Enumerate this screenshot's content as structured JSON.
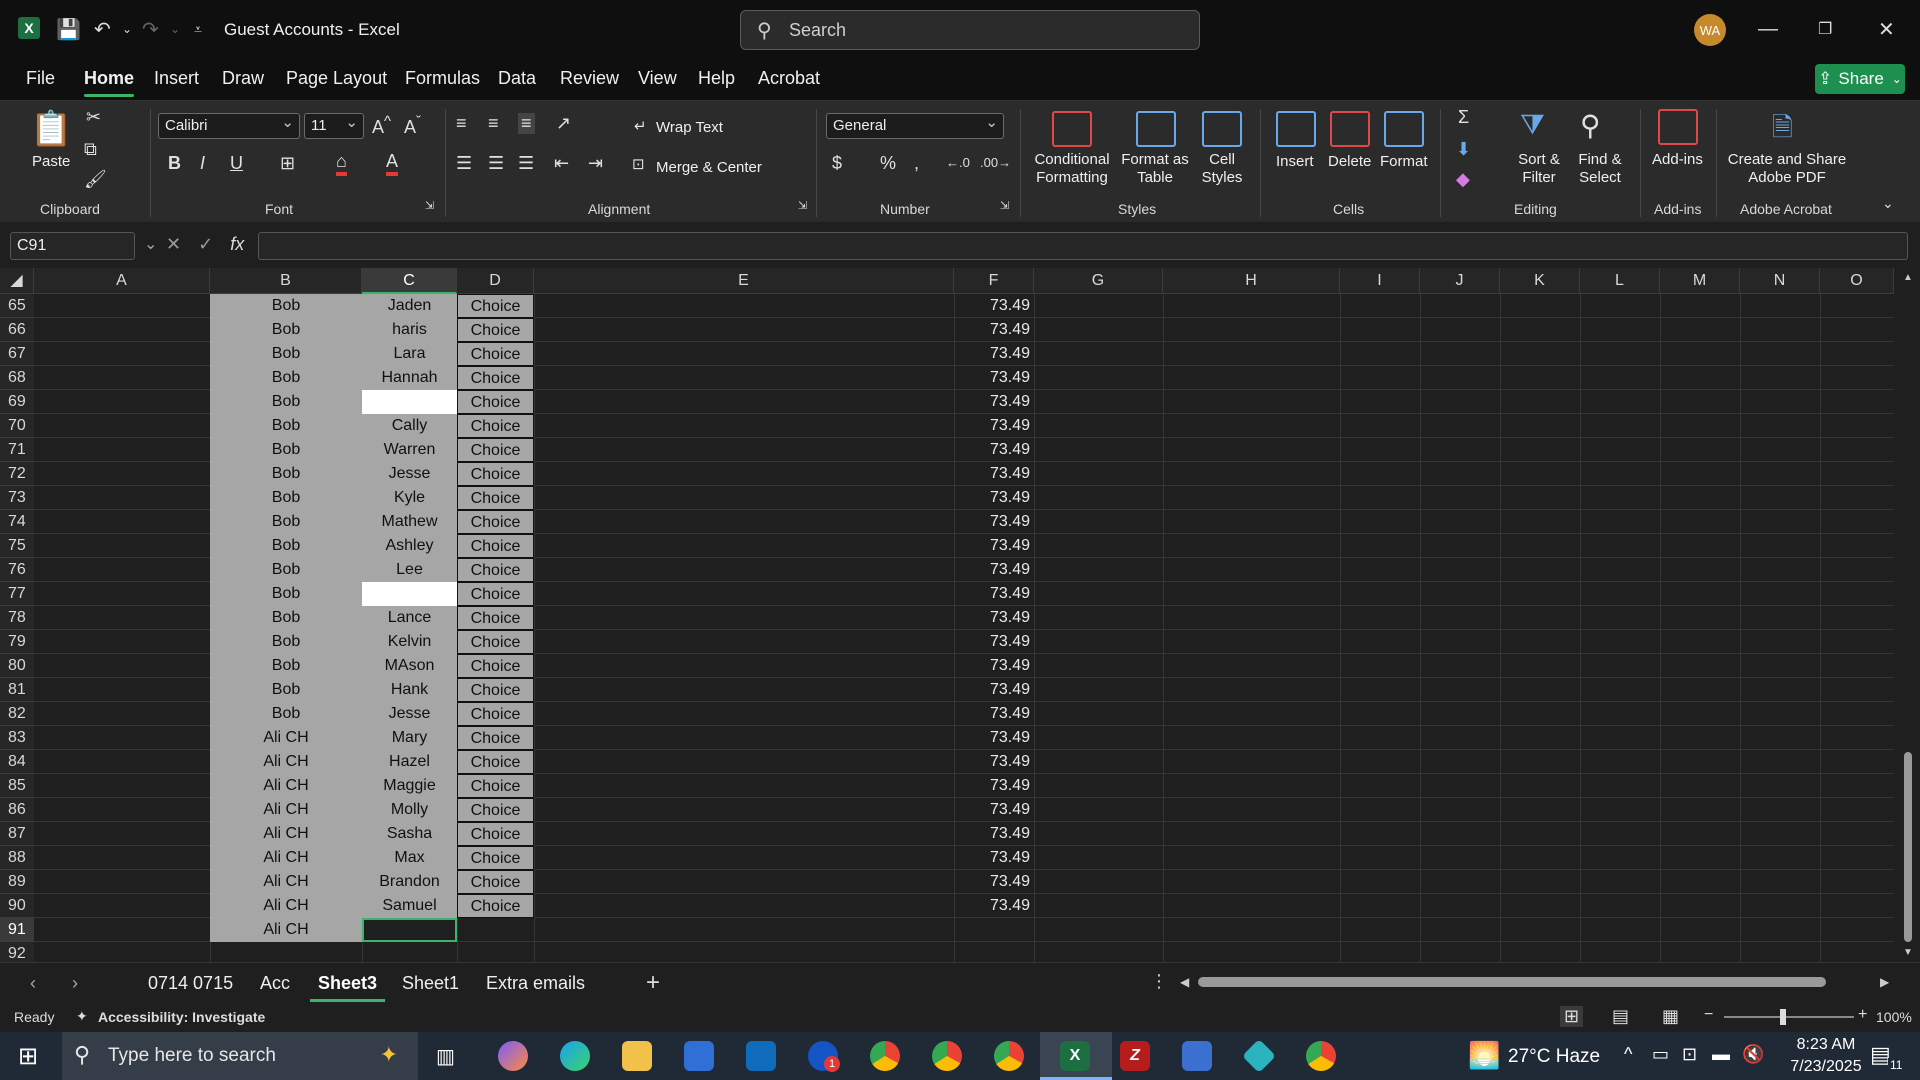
{
  "titlebar": {
    "title": "Guest Accounts  -  Excel",
    "search_placeholder": "Search",
    "avatar_initials": "WA"
  },
  "ribbon_tabs": [
    "File",
    "Home",
    "Insert",
    "Draw",
    "Page Layout",
    "Formulas",
    "Data",
    "Review",
    "View",
    "Help",
    "Acrobat"
  ],
  "active_tab": "Home",
  "share_label": "Share",
  "ribbon": {
    "clipboard": {
      "paste": "Paste",
      "label": "Clipboard"
    },
    "font": {
      "name": "Calibri",
      "size": "11",
      "label": "Font"
    },
    "alignment": {
      "wrap": "Wrap Text",
      "merge": "Merge & Center",
      "label": "Alignment"
    },
    "number": {
      "format": "General",
      "label": "Number"
    },
    "styles": {
      "conditional": "Conditional",
      "conditional2": "Formatting",
      "format_table": "Format as",
      "format_table2": "Table",
      "cell_styles": "Cell",
      "cell_styles2": "Styles",
      "label": "Styles"
    },
    "cells": {
      "insert": "Insert",
      "delete": "Delete",
      "format": "Format",
      "label": "Cells"
    },
    "editing": {
      "sort": "Sort &",
      "sort2": "Filter",
      "find": "Find &",
      "find2": "Select",
      "label": "Editing"
    },
    "addins": {
      "addins": "Add-ins",
      "label": "Add-ins"
    },
    "acrobat": {
      "create": "Create and Share",
      "create2": "Adobe PDF",
      "label": "Adobe Acrobat"
    }
  },
  "formula_bar": {
    "name_box": "C91",
    "formula": ""
  },
  "columns": [
    "A",
    "B",
    "C",
    "D",
    "E",
    "F",
    "G",
    "H",
    "I",
    "J",
    "K",
    "L",
    "M",
    "N",
    "O"
  ],
  "selected_column": "C",
  "rows": [
    {
      "n": "65",
      "b": "Bob",
      "c": "Jaden",
      "d": "Choice",
      "f": "73.49"
    },
    {
      "n": "66",
      "b": "Bob",
      "c": "haris",
      "d": "Choice",
      "f": "73.49"
    },
    {
      "n": "67",
      "b": "Bob",
      "c": "Lara",
      "d": "Choice",
      "f": "73.49"
    },
    {
      "n": "68",
      "b": "Bob",
      "c": "Hannah",
      "d": "Choice",
      "f": "73.49"
    },
    {
      "n": "69",
      "b": "Bob",
      "c": "",
      "d": "Choice",
      "f": "73.49"
    },
    {
      "n": "70",
      "b": "Bob",
      "c": "Cally",
      "d": "Choice",
      "f": "73.49"
    },
    {
      "n": "71",
      "b": "Bob",
      "c": "Warren",
      "d": "Choice",
      "f": "73.49"
    },
    {
      "n": "72",
      "b": "Bob",
      "c": "Jesse",
      "d": "Choice",
      "f": "73.49"
    },
    {
      "n": "73",
      "b": "Bob",
      "c": "Kyle",
      "d": "Choice",
      "f": "73.49"
    },
    {
      "n": "74",
      "b": "Bob",
      "c": "Mathew",
      "d": "Choice",
      "f": "73.49"
    },
    {
      "n": "75",
      "b": "Bob",
      "c": "Ashley",
      "d": "Choice",
      "f": "73.49"
    },
    {
      "n": "76",
      "b": "Bob",
      "c": "Lee",
      "d": "Choice",
      "f": "73.49"
    },
    {
      "n": "77",
      "b": "Bob",
      "c": "",
      "d": "Choice",
      "f": "73.49"
    },
    {
      "n": "78",
      "b": "Bob",
      "c": "Lance",
      "d": "Choice",
      "f": "73.49"
    },
    {
      "n": "79",
      "b": "Bob",
      "c": "Kelvin",
      "d": "Choice",
      "f": "73.49"
    },
    {
      "n": "80",
      "b": "Bob",
      "c": "MAson",
      "d": "Choice",
      "f": "73.49"
    },
    {
      "n": "81",
      "b": "Bob",
      "c": "Hank",
      "d": "Choice",
      "f": "73.49"
    },
    {
      "n": "82",
      "b": "Bob",
      "c": "Jesse",
      "d": "Choice",
      "f": "73.49"
    },
    {
      "n": "83",
      "b": "Ali CH",
      "c": "Mary",
      "d": "Choice",
      "f": "73.49"
    },
    {
      "n": "84",
      "b": "Ali CH",
      "c": "Hazel",
      "d": "Choice",
      "f": "73.49"
    },
    {
      "n": "85",
      "b": "Ali CH",
      "c": "Maggie",
      "d": "Choice",
      "f": "73.49"
    },
    {
      "n": "86",
      "b": "Ali CH",
      "c": "Molly",
      "d": "Choice",
      "f": "73.49"
    },
    {
      "n": "87",
      "b": "Ali CH",
      "c": "Sasha",
      "d": "Choice",
      "f": "73.49"
    },
    {
      "n": "88",
      "b": "Ali CH",
      "c": "Max",
      "d": "Choice",
      "f": "73.49"
    },
    {
      "n": "89",
      "b": "Ali CH",
      "c": "Brandon",
      "d": "Choice",
      "f": "73.49"
    },
    {
      "n": "90",
      "b": "Ali CH",
      "c": "Samuel",
      "d": "Choice",
      "f": "73.49"
    },
    {
      "n": "91",
      "b": "Ali CH",
      "c": "",
      "d": "",
      "f": ""
    },
    {
      "n": "92",
      "b": "",
      "c": "",
      "d": "",
      "f": ""
    }
  ],
  "selected_row": "91",
  "sheets": [
    "0714 0715",
    "Acc",
    "Sheet3",
    "Sheet1",
    "Extra emails"
  ],
  "active_sheet": "Sheet3",
  "status": {
    "ready": "Ready",
    "accessibility": "Accessibility: Investigate",
    "zoom": "100%"
  },
  "taskbar": {
    "search_placeholder": "Type here to search",
    "weather": "27°C  Haze",
    "time": "8:23 AM",
    "date": "7/23/2025",
    "notifications": "11",
    "outlook_badge": "1"
  },
  "colors": {
    "accent": "#3bb56a",
    "excel_green": "#1d6f42",
    "cell_gray": "#a6a6a6"
  }
}
